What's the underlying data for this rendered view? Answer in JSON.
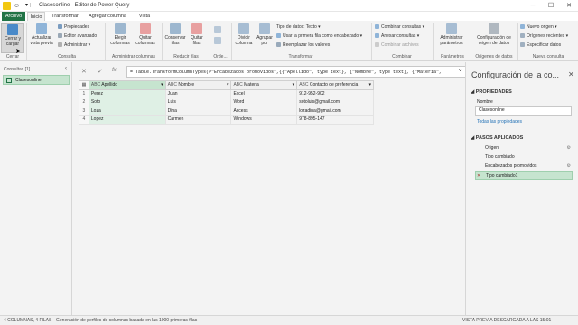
{
  "window": {
    "title": "Clasesonline - Editor de Power Query",
    "controls": [
      "─",
      "☐",
      "✕"
    ]
  },
  "tabs": [
    "Archivo",
    "Inicio",
    "Transformar",
    "Agregar columna",
    "Vista"
  ],
  "ribbon": {
    "cerrar": {
      "label": "Cerrar y cargar",
      "group": "Cerrar"
    },
    "actualizar": {
      "label": "Actualizar vista previa"
    },
    "propiedades": "Propiedades",
    "editor_avanzado": "Editor avanzado",
    "administrar": "Administrar",
    "consulta_group": "Consulta",
    "elegir": "Elegir columnas",
    "quitar": "Quitar columnas",
    "admin_cols_group": "Administrar columnas",
    "conservar": "Conservar filas",
    "quitar_filas": "Quitar filas",
    "reducir_group": "Reducir filas",
    "orden_group": "Orde...",
    "dividir": "Dividir columna",
    "agrupar": "Agrupar por",
    "tipo_datos": "Tipo de datos: Texto",
    "primera_fila": "Usar la primera fila como encabezado",
    "reemplazar": "Reemplazar los valores",
    "transformar_group": "Transformar",
    "combinar_consultas": "Combinar consultas",
    "anexar": "Anexar consultas",
    "combinar_archivos": "Combinar archivos",
    "combinar_group": "Combinar",
    "parametros": "Administrar parámetros",
    "parametros_group": "Parámetros",
    "config_origen": "Configuración de origen de datos",
    "origenes_group": "Orígenes de datos",
    "nuevo_origen": "Nuevo origen",
    "recientes": "Orígenes recientes",
    "especificar": "Especificar datos",
    "nueva_consulta_group": "Nueva consulta"
  },
  "queries": {
    "header": "Consultas [1]",
    "items": [
      "Clasesonline"
    ]
  },
  "formula": {
    "text": "= Table.TransformColumnTypes(#\"Encabezados promovidos\",{{\"Apellido\", type text}, {\"Nombre\", type text}, {\"Materia\","
  },
  "table": {
    "columns": [
      "Apellido",
      "Nombre",
      "Materia",
      "Contacto de preferencia"
    ],
    "type_icon": "ABC",
    "rows": [
      [
        "1",
        "Perez",
        "Juan",
        "Excel",
        "912-952-902"
      ],
      [
        "2",
        "Soto",
        "Luis",
        "Word",
        "sotoluis@gmail.com"
      ],
      [
        "3",
        "Loza",
        "Dina",
        "Access",
        "lozadina@gmail.com"
      ],
      [
        "4",
        "Lopez",
        "Carmen",
        "Windows",
        "978-895-147"
      ]
    ]
  },
  "settings": {
    "title": "Configuración de la co...",
    "propiedades": "PROPIEDADES",
    "nombre_label": "Nombre",
    "nombre_value": "Clasesonline",
    "todas": "Todas las propiedades",
    "pasos": "PASOS APLICADOS",
    "steps": [
      "Origen",
      "Tipo cambiado",
      "Encabezados promovidos",
      "Tipo cambiado1"
    ]
  },
  "status": {
    "left": "4 COLUMNAS, 4 FILAS",
    "middle": "Generación de perfiles de columnas basada en las 1000 primeras filas",
    "right": "VISTA PREVIA DESCARGADA A LAS 15:01"
  },
  "colors": {
    "accent": "#217346",
    "selected": "#c6e4cf"
  }
}
